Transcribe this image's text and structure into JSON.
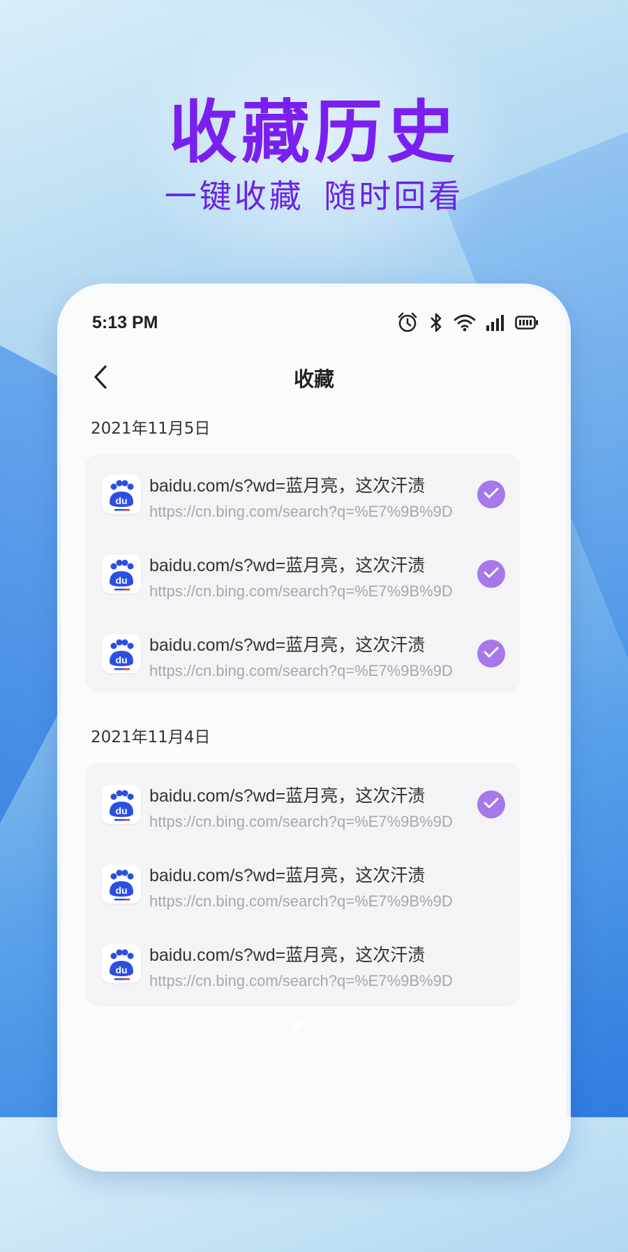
{
  "promo": {
    "title": "收藏历史",
    "subtitle": "一键收藏 随时回看"
  },
  "status_bar": {
    "time": "5:13 PM",
    "icons": [
      "alarm-icon",
      "bluetooth-icon",
      "wifi-icon",
      "signal-icon",
      "battery-icon"
    ]
  },
  "nav": {
    "title": "收藏"
  },
  "groups": [
    {
      "date": "2021年11月5日",
      "items": [
        {
          "title": "baidu.com/s?wd=蓝月亮，这次汗渍",
          "url": "https://cn.bing.com/search?q=%E7%9B%9D",
          "checked": true
        },
        {
          "title": "baidu.com/s?wd=蓝月亮，这次汗渍",
          "url": "https://cn.bing.com/search?q=%E7%9B%9D",
          "checked": true
        },
        {
          "title": "baidu.com/s?wd=蓝月亮，这次汗渍",
          "url": "https://cn.bing.com/search?q=%E7%9B%9D",
          "checked": true
        }
      ]
    },
    {
      "date": "2021年11月4日",
      "items": [
        {
          "title": "baidu.com/s?wd=蓝月亮，这次汗渍",
          "url": "https://cn.bing.com/search?q=%E7%9B%9D",
          "checked": true
        },
        {
          "title": "baidu.com/s?wd=蓝月亮，这次汗渍",
          "url": "https://cn.bing.com/search?q=%E7%9B%9D",
          "checked": false
        },
        {
          "title": "baidu.com/s?wd=蓝月亮，这次汗渍",
          "url": "https://cn.bing.com/search?q=%E7%9B%9D",
          "checked": false
        }
      ]
    }
  ],
  "colors": {
    "accent": "#7a1ff0",
    "check": "#a678ea",
    "baidu_blue": "#2b4fe0",
    "baidu_red": "#e03a2f"
  }
}
